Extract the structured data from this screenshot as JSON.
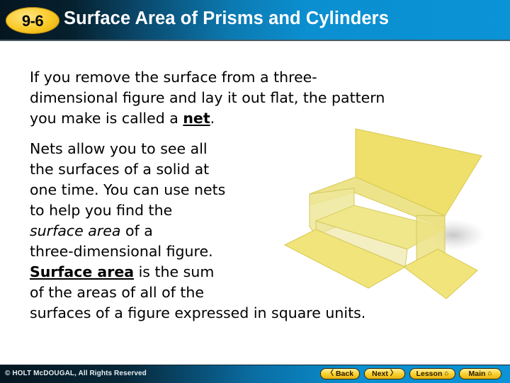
{
  "header": {
    "lesson_badge": "9-6",
    "title": "Surface Area of Prisms and Cylinders"
  },
  "content": {
    "paragraph1": {
      "before": "If you remove the surface from a three-\ndimensional figure and lay it out flat, the pattern\nyou make is called a ",
      "term": "net",
      "after": "."
    },
    "paragraph2": {
      "part1": "Nets allow you to see all\nthe surfaces of a solid at\none time. You can use nets\nto help you find the\n",
      "italic": "surface area",
      "part2": " of a\nthree-dimensional figure.\n",
      "term": "Surface area",
      "part3": " is the sum\nof the areas of all of the\nsurfaces of a figure expressed in square units."
    },
    "figure": {
      "description": "yellow rectangular prism net partially unfolded",
      "color": "#f0e36a"
    }
  },
  "footer": {
    "copyright": "© HOLT McDOUGAL, All Rights Reserved",
    "buttons": {
      "back": {
        "label": "Back",
        "icon": "chevron-left-icon",
        "glyph": "〈"
      },
      "next": {
        "label": "Next",
        "icon": "chevron-right-icon",
        "glyph": "〉"
      },
      "lesson": {
        "label": "Lesson",
        "icon": "home-icon",
        "glyph": "⌂"
      },
      "main": {
        "label": "Main",
        "icon": "home-icon",
        "glyph": "⌂"
      }
    }
  },
  "colors": {
    "header_dark": "#051620",
    "header_blue": "#0a93d6",
    "badge_yellow": "#f8c824",
    "button_yellow": "#f9d232"
  }
}
